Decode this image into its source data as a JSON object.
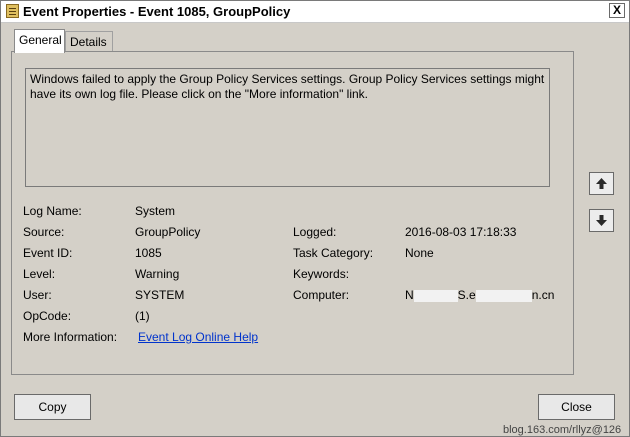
{
  "window": {
    "title": "Event Properties - Event 1085, GroupPolicy",
    "close_glyph": "X"
  },
  "tabs": [
    {
      "label": "General",
      "active": true
    },
    {
      "label": "Details",
      "active": false
    }
  ],
  "general": {
    "description": "Windows failed to apply the Group Policy Services settings. Group Policy Services settings might have its own log file. Please click on the \"More information\" link.",
    "fields": {
      "log_name": {
        "label": "Log Name:",
        "value": "System"
      },
      "source": {
        "label": "Source:",
        "value": "GroupPolicy"
      },
      "event_id": {
        "label": "Event ID:",
        "value": "1085"
      },
      "level": {
        "label": "Level:",
        "value": "Warning"
      },
      "user": {
        "label": "User:",
        "value": "SYSTEM"
      },
      "opcode": {
        "label": "OpCode:",
        "value": "(1)"
      },
      "more_info": {
        "label": "More Information:",
        "value": "Event Log Online Help"
      },
      "logged": {
        "label": "Logged:",
        "value": "2016-08-03 17:18:33"
      },
      "task_category": {
        "label": "Task Category:",
        "value": "None"
      },
      "keywords": {
        "label": "Keywords:",
        "value": ""
      },
      "computer": {
        "label": "Computer:",
        "value_prefix": "N",
        "value_mid": "S.e",
        "value_suffix": "n.cn"
      }
    }
  },
  "nav": {
    "up_icon": "arrow-up-icon",
    "down_icon": "arrow-down-icon"
  },
  "buttons": {
    "copy": "Copy",
    "close": "Close"
  },
  "watermark": "blog.163.com/rllyz@126"
}
